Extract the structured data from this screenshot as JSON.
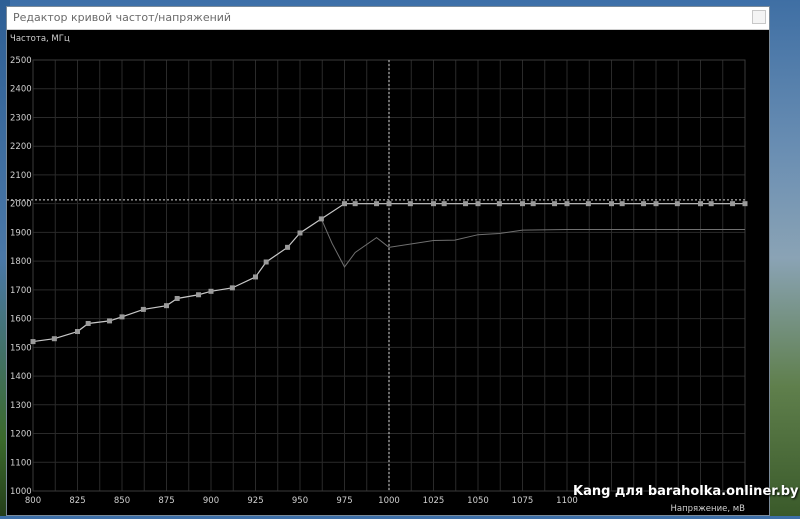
{
  "window": {
    "title": "Редактор кривой частот/напряжений"
  },
  "icons": {
    "close": "close-icon"
  },
  "colors": {
    "background": "#000000",
    "grid": "#2a2a2a",
    "axis_text": "#d0d0d0",
    "curve": "#c8c8c8",
    "curve_dim": "#707070",
    "markers": "#9a9a9a",
    "guide": "#d8d8d8"
  },
  "chart_data": {
    "type": "line",
    "ylabel": "Частота, МГц",
    "xlabel": "Напряжение, мВ",
    "xlim": [
      800,
      1200
    ],
    "ylim": [
      1000,
      2500
    ],
    "x_ticks": [
      800,
      825,
      850,
      875,
      900,
      925,
      950,
      975,
      1000,
      1025,
      1050,
      1075,
      1100
    ],
    "y_ticks": [
      1000,
      1100,
      1200,
      1300,
      1400,
      1500,
      1600,
      1700,
      1800,
      1900,
      2000,
      2100,
      2200,
      2300,
      2400,
      2500
    ],
    "grid": true,
    "crosshair": {
      "x": 1000,
      "y": 2013
    },
    "series": [
      {
        "values": [
          [
            800,
            1520
          ],
          [
            812,
            1530
          ],
          [
            825,
            1555
          ],
          [
            831,
            1583
          ],
          [
            843,
            1592
          ],
          [
            850,
            1606
          ],
          [
            862,
            1632
          ],
          [
            875,
            1645
          ],
          [
            881,
            1670
          ],
          [
            893,
            1683
          ],
          [
            900,
            1695
          ],
          [
            912,
            1707
          ],
          [
            925,
            1745
          ],
          [
            931,
            1797
          ],
          [
            943,
            1848
          ],
          [
            950,
            1898
          ],
          [
            962,
            1947
          ],
          [
            975,
            2000
          ],
          [
            981,
            2000
          ],
          [
            993,
            2000
          ],
          [
            1000,
            2000
          ],
          [
            1012,
            2000
          ],
          [
            1025,
            2000
          ],
          [
            1031,
            2000
          ],
          [
            1043,
            2000
          ],
          [
            1050,
            2000
          ],
          [
            1062,
            2000
          ],
          [
            1075,
            2000
          ],
          [
            1081,
            2000
          ],
          [
            1093,
            2000
          ],
          [
            1100,
            2000
          ],
          [
            1112,
            2000
          ],
          [
            1125,
            2000
          ],
          [
            1131,
            2000
          ],
          [
            1143,
            2000
          ],
          [
            1150,
            2000
          ],
          [
            1162,
            2000
          ],
          [
            1175,
            2000
          ],
          [
            1181,
            2000
          ],
          [
            1193,
            2000
          ],
          [
            1200,
            2000
          ]
        ]
      },
      {
        "values": [
          [
            962,
            1947
          ],
          [
            968,
            1862
          ],
          [
            975,
            1780
          ],
          [
            981,
            1830
          ],
          [
            993,
            1882
          ],
          [
            1000,
            1848
          ],
          [
            1025,
            1872
          ],
          [
            1037,
            1873
          ],
          [
            1050,
            1892
          ],
          [
            1062,
            1896
          ],
          [
            1075,
            1908
          ],
          [
            1100,
            1910
          ],
          [
            1125,
            1910
          ],
          [
            1150,
            1910
          ],
          [
            1175,
            1910
          ],
          [
            1200,
            1910
          ]
        ]
      }
    ]
  },
  "watermark": "Kang для baraholka.onliner.by"
}
